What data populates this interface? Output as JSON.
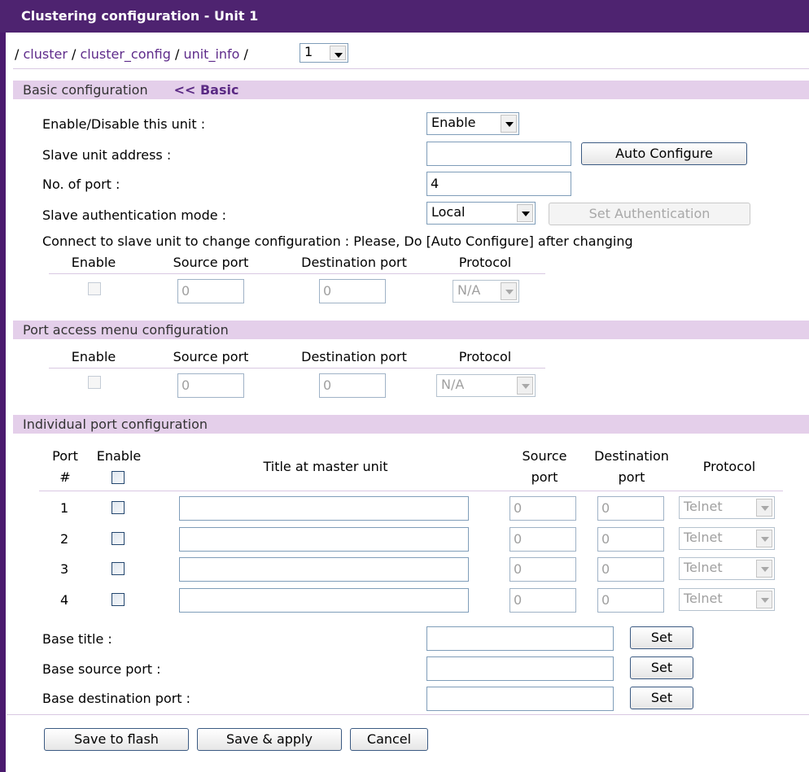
{
  "title": "Clustering configuration - Unit 1",
  "breadcrumb": {
    "sep": "/",
    "parts": [
      "cluster",
      "cluster_config",
      "unit_info"
    ],
    "unit_select": "1"
  },
  "basic": {
    "heading": "Basic configuration",
    "link": "<< Basic",
    "enable_label": "Enable/Disable this unit :",
    "enable_value": "Enable",
    "slave_addr_label": "Slave unit address :",
    "slave_addr_value": "",
    "auto_configure": "Auto Configure",
    "nport_label": "No. of port :",
    "nport_value": "4",
    "auth_label": "Slave authentication mode :",
    "auth_value": "Local",
    "set_auth": "Set Authentication",
    "connect_note": "Connect to slave unit to change configuration : Please, Do [Auto Configure] after changing",
    "cols": {
      "enable": "Enable",
      "src": "Source port",
      "dst": "Destination port",
      "proto": "Protocol"
    },
    "row": {
      "src": "0",
      "dst": "0",
      "proto": "N/A"
    }
  },
  "access": {
    "heading": "Port access menu configuration",
    "cols": {
      "enable": "Enable",
      "src": "Source port",
      "dst": "Destination port",
      "proto": "Protocol"
    },
    "row": {
      "src": "0",
      "dst": "0",
      "proto": "N/A"
    }
  },
  "individual": {
    "heading": "Individual port configuration",
    "cols": {
      "port1": "Port",
      "port2": "#",
      "enable": "Enable",
      "title": "Title at master unit",
      "src1": "Source",
      "src2": "port",
      "dst1": "Destination",
      "dst2": "port",
      "proto": "Protocol"
    },
    "rows": [
      {
        "n": "1",
        "title": "",
        "src": "0",
        "dst": "0",
        "proto": "Telnet"
      },
      {
        "n": "2",
        "title": "",
        "src": "0",
        "dst": "0",
        "proto": "Telnet"
      },
      {
        "n": "3",
        "title": "",
        "src": "0",
        "dst": "0",
        "proto": "Telnet"
      },
      {
        "n": "4",
        "title": "",
        "src": "0",
        "dst": "0",
        "proto": "Telnet"
      }
    ],
    "base_title_label": "Base title :",
    "base_src_label": "Base source port :",
    "base_dst_label": "Base destination port :",
    "set": "Set"
  },
  "footer": {
    "save_flash": "Save to flash",
    "save_apply": "Save & apply",
    "cancel": "Cancel"
  }
}
